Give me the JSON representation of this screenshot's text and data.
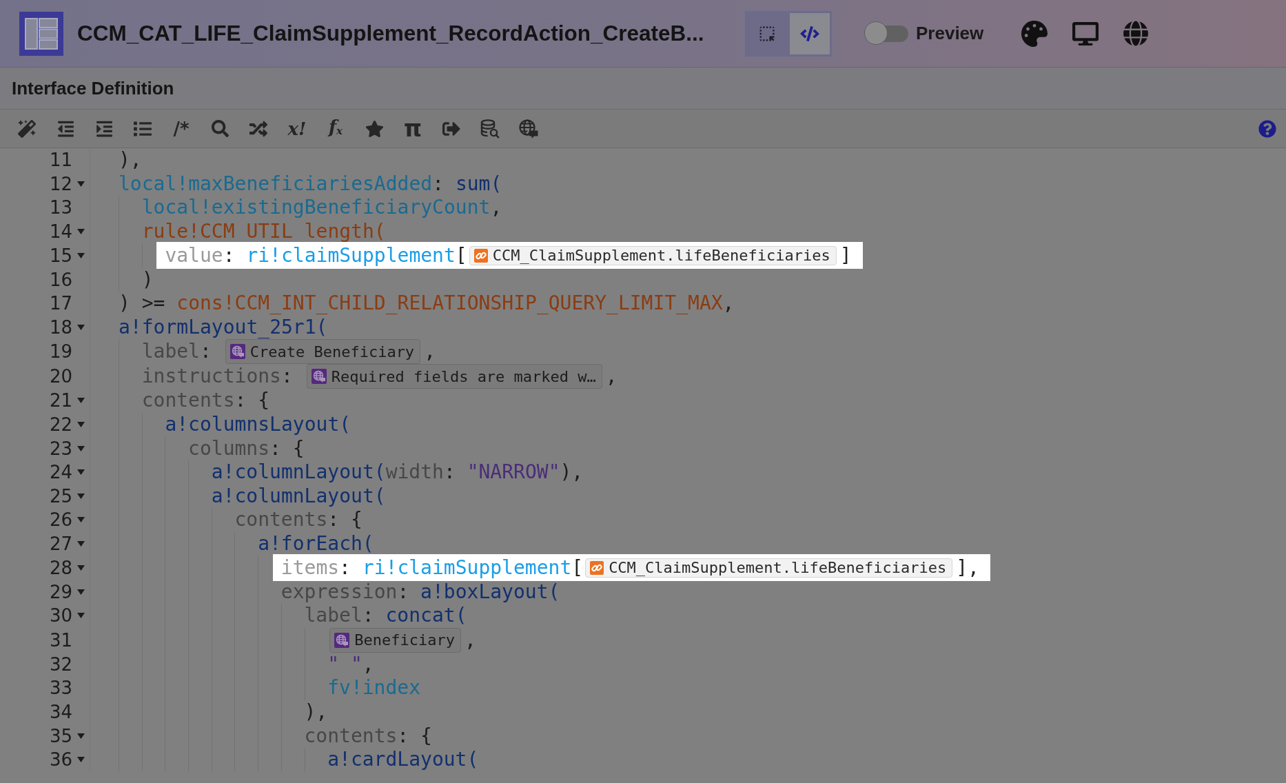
{
  "header": {
    "title": "CCM_CAT_LIFE_ClaimSupplement_RecordAction_CreateB...",
    "view_modes": [
      {
        "kind": "design",
        "selected": false
      },
      {
        "kind": "code",
        "selected": true
      }
    ],
    "preview": {
      "label": "Preview",
      "on": false
    }
  },
  "panel": {
    "title": "Interface Definition"
  },
  "toolbar": {
    "glyph_buttons": [
      "/*",
      "x!",
      "f$_{x}$",
      "π"
    ]
  },
  "editor": {
    "lines": [
      {
        "number": "11",
        "foldable": false,
        "highlighted": false,
        "tokens": [
          {
            "kind": "plain",
            "text": "),"
          }
        ]
      },
      {
        "number": "12",
        "foldable": true,
        "highlighted": false,
        "tokens": [
          {
            "kind": "variable",
            "text": "local!maxBeneficiariesAdded"
          },
          {
            "kind": "plain",
            "text": ": "
          },
          {
            "kind": "function",
            "text": "sum("
          }
        ],
        "children": [
          {
            "number": "13",
            "foldable": false,
            "highlighted": false,
            "tokens": [
              {
                "kind": "variable",
                "text": "local!existingBeneficiaryCount"
              },
              {
                "kind": "plain",
                "text": ","
              }
            ]
          },
          {
            "number": "14",
            "foldable": true,
            "highlighted": false,
            "tokens": [
              {
                "kind": "rule",
                "text": "rule!CCM_UTIL_length("
              }
            ],
            "children": [
              {
                "number": "15",
                "foldable": true,
                "highlighted": true,
                "tokens": [
                  {
                    "kind": "param",
                    "text": "value"
                  },
                  {
                    "kind": "plain",
                    "text": ": "
                  },
                  {
                    "kind": "input",
                    "text": "ri!claimSupplement"
                  },
                  {
                    "kind": "plain",
                    "text": "["
                  },
                  {
                    "kind": "record-chip",
                    "text": "CCM_ClaimSupplement.lifeBeneficiaries"
                  },
                  {
                    "kind": "plain",
                    "text": "]"
                  }
                ]
              }
            ]
          },
          {
            "number": "16",
            "foldable": false,
            "highlighted": false,
            "tokens": [
              {
                "kind": "plain",
                "text": ")"
              }
            ]
          }
        ]
      },
      {
        "number": "17",
        "foldable": false,
        "highlighted": false,
        "tokens": [
          {
            "kind": "plain",
            "text": ") >= "
          },
          {
            "kind": "constant",
            "text": "cons!CCM_INT_CHILD_RELATIONSHIP_QUERY_LIMIT_MAX"
          },
          {
            "kind": "plain",
            "text": ","
          }
        ]
      },
      {
        "number": "18",
        "foldable": true,
        "highlighted": false,
        "tokens": [
          {
            "kind": "function",
            "text": "a!formLayout_25r1("
          }
        ],
        "children": [
          {
            "number": "19",
            "foldable": false,
            "highlighted": false,
            "tokens": [
              {
                "kind": "param",
                "text": "label"
              },
              {
                "kind": "plain",
                "text": ": "
              },
              {
                "kind": "translation-chip",
                "text": "Create Beneficiary"
              },
              {
                "kind": "plain",
                "text": ","
              }
            ]
          },
          {
            "number": "20",
            "foldable": false,
            "highlighted": false,
            "tokens": [
              {
                "kind": "param",
                "text": "instructions"
              },
              {
                "kind": "plain",
                "text": ": "
              },
              {
                "kind": "translation-chip",
                "text": "Required fields are marked w…"
              },
              {
                "kind": "plain",
                "text": ","
              }
            ]
          },
          {
            "number": "21",
            "foldable": true,
            "highlighted": false,
            "tokens": [
              {
                "kind": "param",
                "text": "contents"
              },
              {
                "kind": "plain",
                "text": ": {"
              }
            ],
            "children": [
              {
                "number": "22",
                "foldable": true,
                "highlighted": false,
                "tokens": [
                  {
                    "kind": "function",
                    "text": "a!columnsLayout("
                  }
                ],
                "children": [
                  {
                    "number": "23",
                    "foldable": true,
                    "highlighted": false,
                    "tokens": [
                      {
                        "kind": "param",
                        "text": "columns"
                      },
                      {
                        "kind": "plain",
                        "text": ": {"
                      }
                    ],
                    "children": [
                      {
                        "number": "24",
                        "foldable": true,
                        "highlighted": false,
                        "tokens": [
                          {
                            "kind": "function",
                            "text": "a!columnLayout("
                          },
                          {
                            "kind": "param",
                            "text": "width"
                          },
                          {
                            "kind": "plain",
                            "text": ": "
                          },
                          {
                            "kind": "string",
                            "text": "\"NARROW\""
                          },
                          {
                            "kind": "plain",
                            "text": "),"
                          }
                        ]
                      },
                      {
                        "number": "25",
                        "foldable": true,
                        "highlighted": false,
                        "tokens": [
                          {
                            "kind": "function",
                            "text": "a!columnLayout("
                          }
                        ],
                        "children": [
                          {
                            "number": "26",
                            "foldable": true,
                            "highlighted": false,
                            "tokens": [
                              {
                                "kind": "param",
                                "text": "contents"
                              },
                              {
                                "kind": "plain",
                                "text": ": {"
                              }
                            ],
                            "children": [
                              {
                                "number": "27",
                                "foldable": true,
                                "highlighted": false,
                                "tokens": [
                                  {
                                    "kind": "function",
                                    "text": "a!forEach("
                                  }
                                ],
                                "children": [
                                  {
                                    "number": "28",
                                    "foldable": true,
                                    "highlighted": true,
                                    "tokens": [
                                      {
                                        "kind": "param",
                                        "text": "items"
                                      },
                                      {
                                        "kind": "plain",
                                        "text": ": "
                                      },
                                      {
                                        "kind": "input",
                                        "text": "ri!claimSupplement"
                                      },
                                      {
                                        "kind": "plain",
                                        "text": "["
                                      },
                                      {
                                        "kind": "record-chip",
                                        "text": "CCM_ClaimSupplement.lifeBeneficiaries"
                                      },
                                      {
                                        "kind": "plain",
                                        "text": "],"
                                      }
                                    ]
                                  },
                                  {
                                    "number": "29",
                                    "foldable": true,
                                    "highlighted": false,
                                    "tokens": [
                                      {
                                        "kind": "param",
                                        "text": "expression"
                                      },
                                      {
                                        "kind": "plain",
                                        "text": ": "
                                      },
                                      {
                                        "kind": "function",
                                        "text": "a!boxLayout("
                                      }
                                    ],
                                    "children": [
                                      {
                                        "number": "30",
                                        "foldable": true,
                                        "highlighted": false,
                                        "tokens": [
                                          {
                                            "kind": "param",
                                            "text": "label"
                                          },
                                          {
                                            "kind": "plain",
                                            "text": ": "
                                          },
                                          {
                                            "kind": "function",
                                            "text": "concat("
                                          }
                                        ],
                                        "children": [
                                          {
                                            "number": "31",
                                            "foldable": false,
                                            "highlighted": false,
                                            "tokens": [
                                              {
                                                "kind": "translation-chip",
                                                "text": "Beneficiary"
                                              },
                                              {
                                                "kind": "plain",
                                                "text": ","
                                              }
                                            ]
                                          },
                                          {
                                            "number": "32",
                                            "foldable": false,
                                            "highlighted": false,
                                            "tokens": [
                                              {
                                                "kind": "string",
                                                "text": "\" \""
                                              },
                                              {
                                                "kind": "plain",
                                                "text": ","
                                              }
                                            ]
                                          },
                                          {
                                            "number": "33",
                                            "foldable": false,
                                            "highlighted": false,
                                            "tokens": [
                                              {
                                                "kind": "variable",
                                                "text": "fv!index"
                                              }
                                            ]
                                          }
                                        ]
                                      },
                                      {
                                        "number": "34",
                                        "foldable": false,
                                        "highlighted": false,
                                        "tokens": [
                                          {
                                            "kind": "plain",
                                            "text": "),"
                                          }
                                        ]
                                      },
                                      {
                                        "number": "35",
                                        "foldable": true,
                                        "highlighted": false,
                                        "tokens": [
                                          {
                                            "kind": "param",
                                            "text": "contents"
                                          },
                                          {
                                            "kind": "plain",
                                            "text": ": {"
                                          }
                                        ],
                                        "children": [
                                          {
                                            "number": "36",
                                            "foldable": true,
                                            "highlighted": false,
                                            "tokens": [
                                              {
                                                "kind": "function",
                                                "text": "a!cardLayout("
                                              }
                                            ]
                                          }
                                        ]
                                      }
                                    ]
                                  }
                                ]
                              }
                            ]
                          }
                        ]
                      }
                    ]
                  }
                ]
              }
            ]
          }
        ]
      }
    ]
  }
}
